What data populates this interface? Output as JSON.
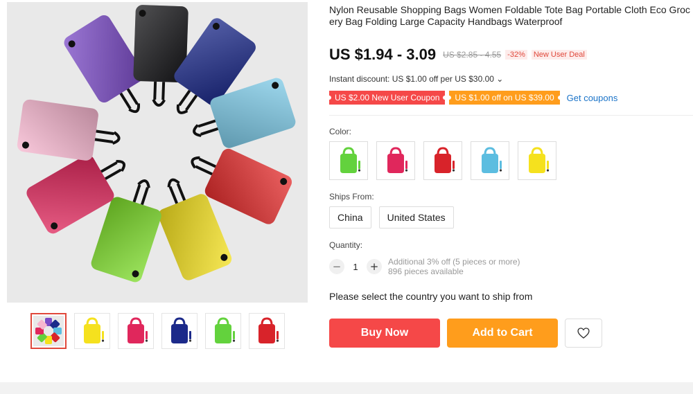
{
  "product": {
    "title": "Nylon Reusable Shopping Bags Women Foldable Tote Bag Portable Cloth Eco Grocery Bag Folding Large Capacity Handbags Waterproof",
    "price": "US $1.94 - 3.09",
    "original_price": "US $2.85 - 4.55",
    "discount": "-32%",
    "deal_badge": "New User Deal",
    "instant_discount": "Instant discount: US $1.00 off per US $30.00 ⌄"
  },
  "coupons": {
    "new_user": "US $2.00 New User Coupon",
    "store": "US $1.00 off on US $39.00",
    "get_link": "Get coupons"
  },
  "color": {
    "label": "Color:",
    "options": [
      {
        "name": "green",
        "hex": "#63d23d"
      },
      {
        "name": "rose",
        "hex": "#e0275c"
      },
      {
        "name": "red",
        "hex": "#d8232a"
      },
      {
        "name": "sky-blue",
        "hex": "#5cbde0"
      },
      {
        "name": "yellow",
        "hex": "#f5e11e"
      }
    ]
  },
  "ships_from": {
    "label": "Ships From:",
    "options": [
      "China",
      "United States"
    ]
  },
  "quantity": {
    "label": "Quantity:",
    "value": "1",
    "minus": "−",
    "plus": "+",
    "offer": "Additional 3% off (5 pieces or more)",
    "available": "896 pieces available"
  },
  "select_message": "Please select the country you want to ship from",
  "actions": {
    "buy_now": "Buy Now",
    "add_to_cart": "Add to Cart",
    "wishlist_icon": "heart-icon"
  },
  "gallery": {
    "thumbnails": [
      {
        "name": "all-colors",
        "hex": "#7b4bc7"
      },
      {
        "name": "yellow",
        "hex": "#f5e11e"
      },
      {
        "name": "rose",
        "hex": "#e0275c"
      },
      {
        "name": "navy",
        "hex": "#1c2a8a"
      },
      {
        "name": "green",
        "hex": "#63d23d"
      },
      {
        "name": "red",
        "hex": "#d8232a"
      }
    ]
  },
  "theme": {
    "accent_red": "#f54848",
    "accent_orange": "#ff9d1c",
    "link_blue": "#1a73c8"
  }
}
